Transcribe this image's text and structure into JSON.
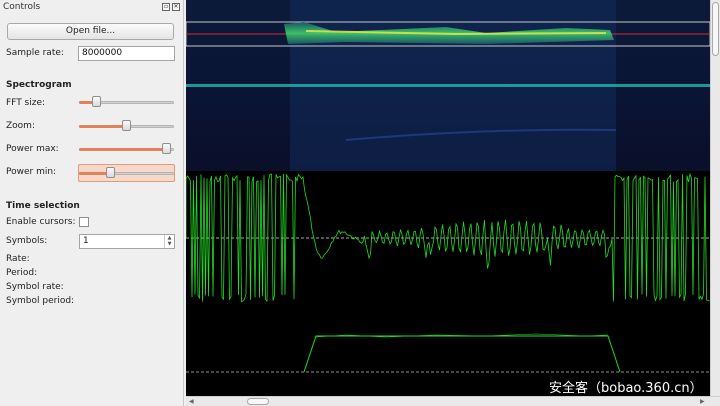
{
  "dock": {
    "title": "Controls",
    "float_btn": "▫",
    "close_btn": "✕",
    "open_file_label": "Open file...",
    "sample_rate_label": "Sample rate:",
    "sample_rate_value": "8000000"
  },
  "spectrogram": {
    "heading": "Spectrogram",
    "fft_size_label": "FFT size:",
    "fft_size_level": 0.18,
    "zoom_label": "Zoom:",
    "zoom_level": 0.49,
    "power_max_label": "Power max:",
    "power_max_level": 0.92,
    "power_min_label": "Power min:",
    "power_min_level": 0.33
  },
  "time_selection": {
    "heading": "Time selection",
    "enable_cursors_label": "Enable cursors:",
    "enable_cursors_checked": false,
    "symbols_label": "Symbols:",
    "symbols_value": "1",
    "rate_label": "Rate:",
    "period_label": "Period:",
    "symbol_rate_label": "Symbol rate:",
    "symbol_period_label": "Symbol period:"
  },
  "watermark": "安全客（bobao.360.cn）",
  "colors": {
    "accent": "#e2825a",
    "trace": "#22dd22",
    "plot_bg": "#000000",
    "spectrogram_bg": "#0d1030"
  }
}
